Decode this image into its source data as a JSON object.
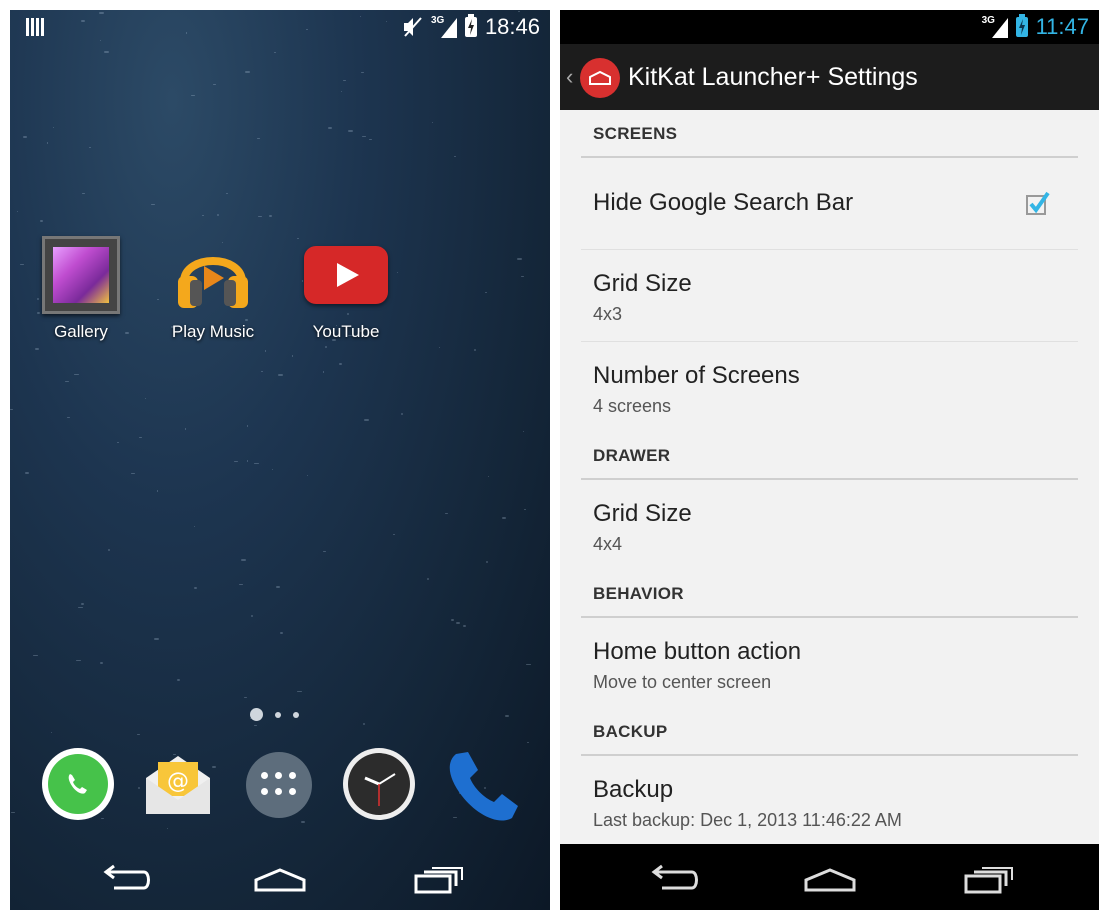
{
  "left": {
    "status_time": "18:46",
    "network": "3G",
    "apps": [
      {
        "label": "Gallery",
        "icon": "gallery-icon"
      },
      {
        "label": "Play Music",
        "icon": "headphones-icon"
      },
      {
        "label": "YouTube",
        "icon": "youtube-icon"
      }
    ],
    "dock": [
      "whatsapp-icon",
      "email-icon",
      "app-drawer-icon",
      "clock-icon",
      "phone-icon"
    ],
    "page_indicator": {
      "pages": 3,
      "current": 1
    }
  },
  "right": {
    "status_time": "11:47",
    "network": "3G",
    "title": "KitKat Launcher+ Settings",
    "sections": [
      {
        "header": "SCREENS",
        "items": [
          {
            "title": "Hide Google Search Bar",
            "checked": true
          },
          {
            "title": "Grid Size",
            "summary": "4x3"
          },
          {
            "title": "Number of Screens",
            "summary": "4 screens"
          }
        ]
      },
      {
        "header": "DRAWER",
        "items": [
          {
            "title": "Grid Size",
            "summary": "4x4"
          }
        ]
      },
      {
        "header": "BEHAVIOR",
        "items": [
          {
            "title": "Home button action",
            "summary": "Move to center screen"
          }
        ]
      },
      {
        "header": "BACKUP",
        "items": [
          {
            "title": "Backup",
            "summary": "Last backup: Dec 1, 2013 11:46:22 AM"
          }
        ]
      }
    ]
  },
  "colors": {
    "accent": "#33b5e5",
    "logo": "#d8302f",
    "actionbar": "#1c1c1c"
  }
}
